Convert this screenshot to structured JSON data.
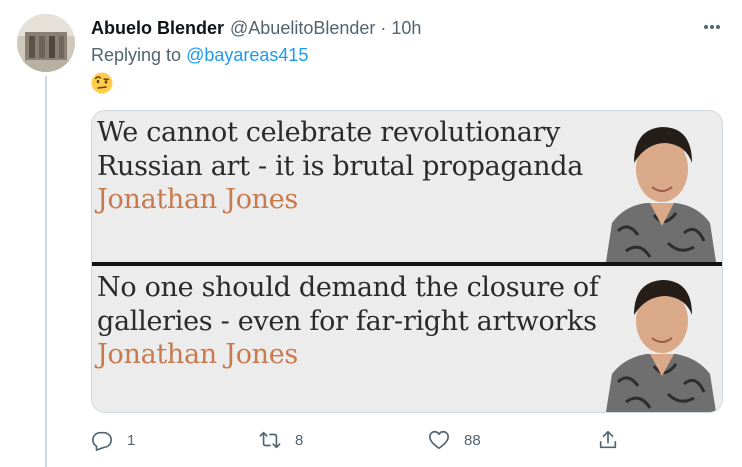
{
  "tweet": {
    "display_name": "Abuelo Blender",
    "handle": "@AbuelitoBlender",
    "separator": "·",
    "time": "10h",
    "reply_prefix": "Replying to",
    "reply_to": "@bayareas415",
    "emoji": "🤨"
  },
  "media": {
    "panels": [
      {
        "headline_line1": "We cannot celebrate revolutionary",
        "headline_line2": "Russian art - it is brutal propaganda",
        "byline": "Jonathan Jones"
      },
      {
        "headline_line1": "No one should demand the closure of",
        "headline_line2": "galleries - even for far-right artworks",
        "byline": "Jonathan Jones"
      }
    ]
  },
  "actions": {
    "reply_count": "1",
    "retweet_count": "8",
    "like_count": "88",
    "share_count": ""
  },
  "colors": {
    "secondary_text": "#536471",
    "link": "#1d9bf0",
    "byline": "#c97a4d",
    "thread_line": "#cfd9de"
  }
}
